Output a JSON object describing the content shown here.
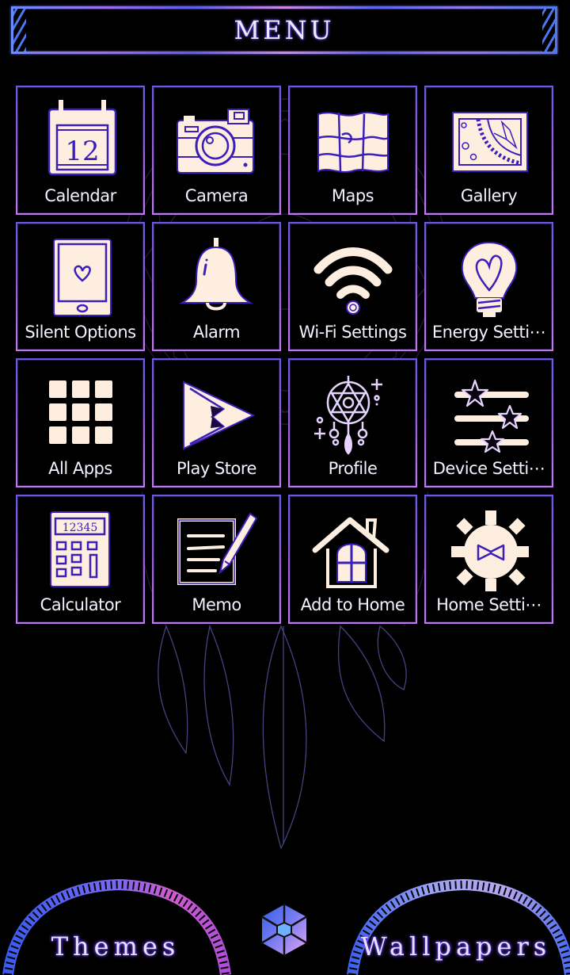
{
  "header": {
    "title": "MENU"
  },
  "colors": {
    "background": "#000000",
    "tile_border": "#7b55c9",
    "icon_fill": "#fdeee0",
    "icon_stroke": "#3b1fb8",
    "label_text": "#f4f0ff",
    "accent_blue": "#4f74ef",
    "accent_pink": "#c060d0"
  },
  "tiles": [
    {
      "label": "Calendar",
      "icon": "calendar-icon",
      "icon_text": "12"
    },
    {
      "label": "Camera",
      "icon": "camera-icon"
    },
    {
      "label": "Maps",
      "icon": "map-icon"
    },
    {
      "label": "Gallery",
      "icon": "gallery-icon"
    },
    {
      "label": "Silent Options",
      "icon": "phone-heart-icon"
    },
    {
      "label": "Alarm",
      "icon": "bell-icon"
    },
    {
      "label": "Wi-Fi Settings",
      "icon": "wifi-icon"
    },
    {
      "label": "Energy Setti⋯",
      "icon": "lightbulb-heart-icon"
    },
    {
      "label": "All Apps",
      "icon": "app-grid-icon"
    },
    {
      "label": "Play Store",
      "icon": "play-store-icon"
    },
    {
      "label": "Profile",
      "icon": "dreamcatcher-icon"
    },
    {
      "label": "Device Setti⋯",
      "icon": "star-sliders-icon"
    },
    {
      "label": "Calculator",
      "icon": "calculator-icon",
      "icon_text": "12345"
    },
    {
      "label": "Memo",
      "icon": "memo-pencil-icon"
    },
    {
      "label": "Add to Home",
      "icon": "house-icon"
    },
    {
      "label": "Home Setti⋯",
      "icon": "gear-bowtie-icon"
    }
  ],
  "bottom": {
    "themes_label": "Themes",
    "wallpapers_label": "Wallpapers",
    "center_icon": "hexagon-gem-icon"
  }
}
